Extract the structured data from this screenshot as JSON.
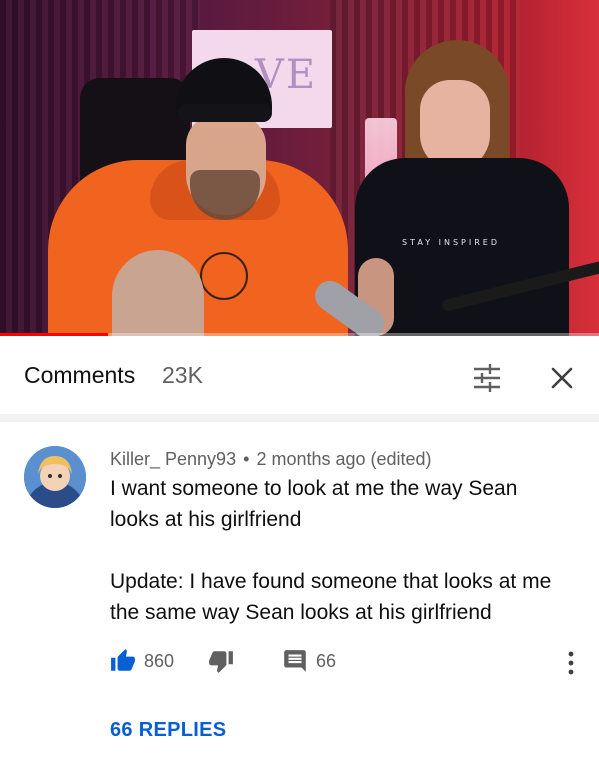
{
  "video": {
    "wall_sign_text": "VE",
    "shirt_text": "STAY INSPIRED",
    "progress_fraction": 0.18
  },
  "comments_header": {
    "title": "Comments",
    "count": "23K",
    "sort_icon": "sort-filter-icon",
    "close_icon": "close-icon"
  },
  "comment": {
    "author": "Killer_ Penny93",
    "separator": "•",
    "time": "2 months ago (edited)",
    "body_lines": [
      "I want someone to look at me the way Sean",
      "looks at his girlfriend",
      "",
      "Update: I have found someone that looks at me",
      "the same way Sean looks at his girlfriend"
    ],
    "likes": "860",
    "reply_count_label": "66",
    "replies_link": "66 REPLIES",
    "colors": {
      "like_active": "#065fd4",
      "icon_gray": "#606060",
      "link_blue": "#065fd4"
    }
  }
}
